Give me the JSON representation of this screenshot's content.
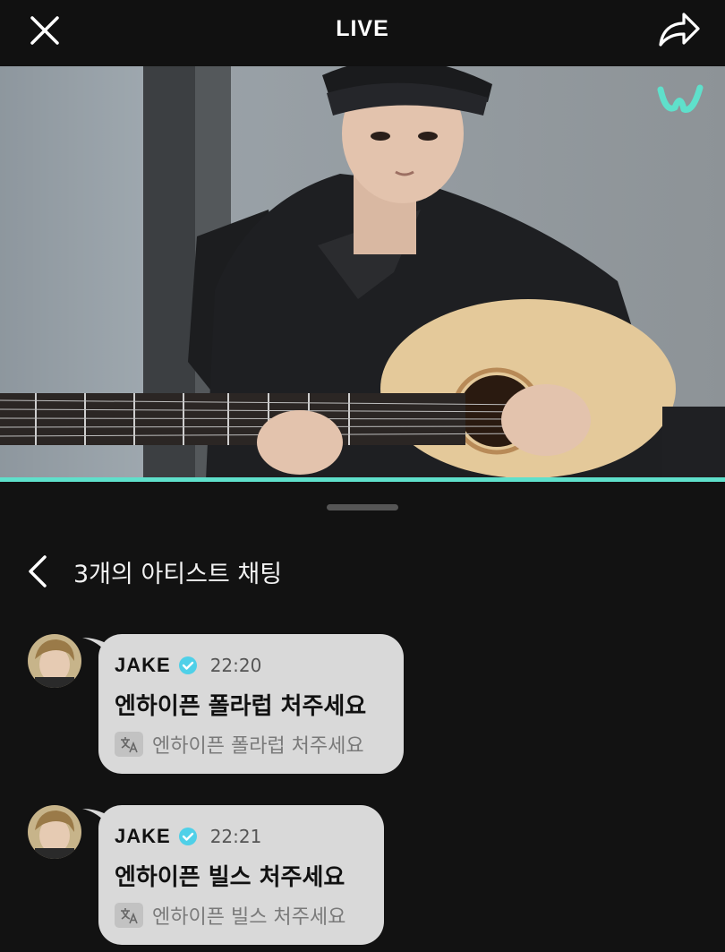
{
  "header": {
    "title": "LIVE",
    "close_icon": "close-icon",
    "share_icon": "share-icon"
  },
  "video": {
    "watermark_icon": "weverse-logo-icon",
    "progress": 1.0,
    "accent": "#5fe0cb"
  },
  "chat": {
    "title": "3개의 아티스트 채팅",
    "back_icon": "chevron-left-icon",
    "messages": [
      {
        "name": "JAKE",
        "time": "22:20",
        "text": "엔하이픈 폴라럽 처주세요",
        "translation": "엔하이픈 폴라럽 처주세요"
      },
      {
        "name": "JAKE",
        "time": "22:21",
        "text": "엔하이픈 빌스 처주세요",
        "translation": "엔하이픈 빌스 처주세요"
      }
    ]
  }
}
